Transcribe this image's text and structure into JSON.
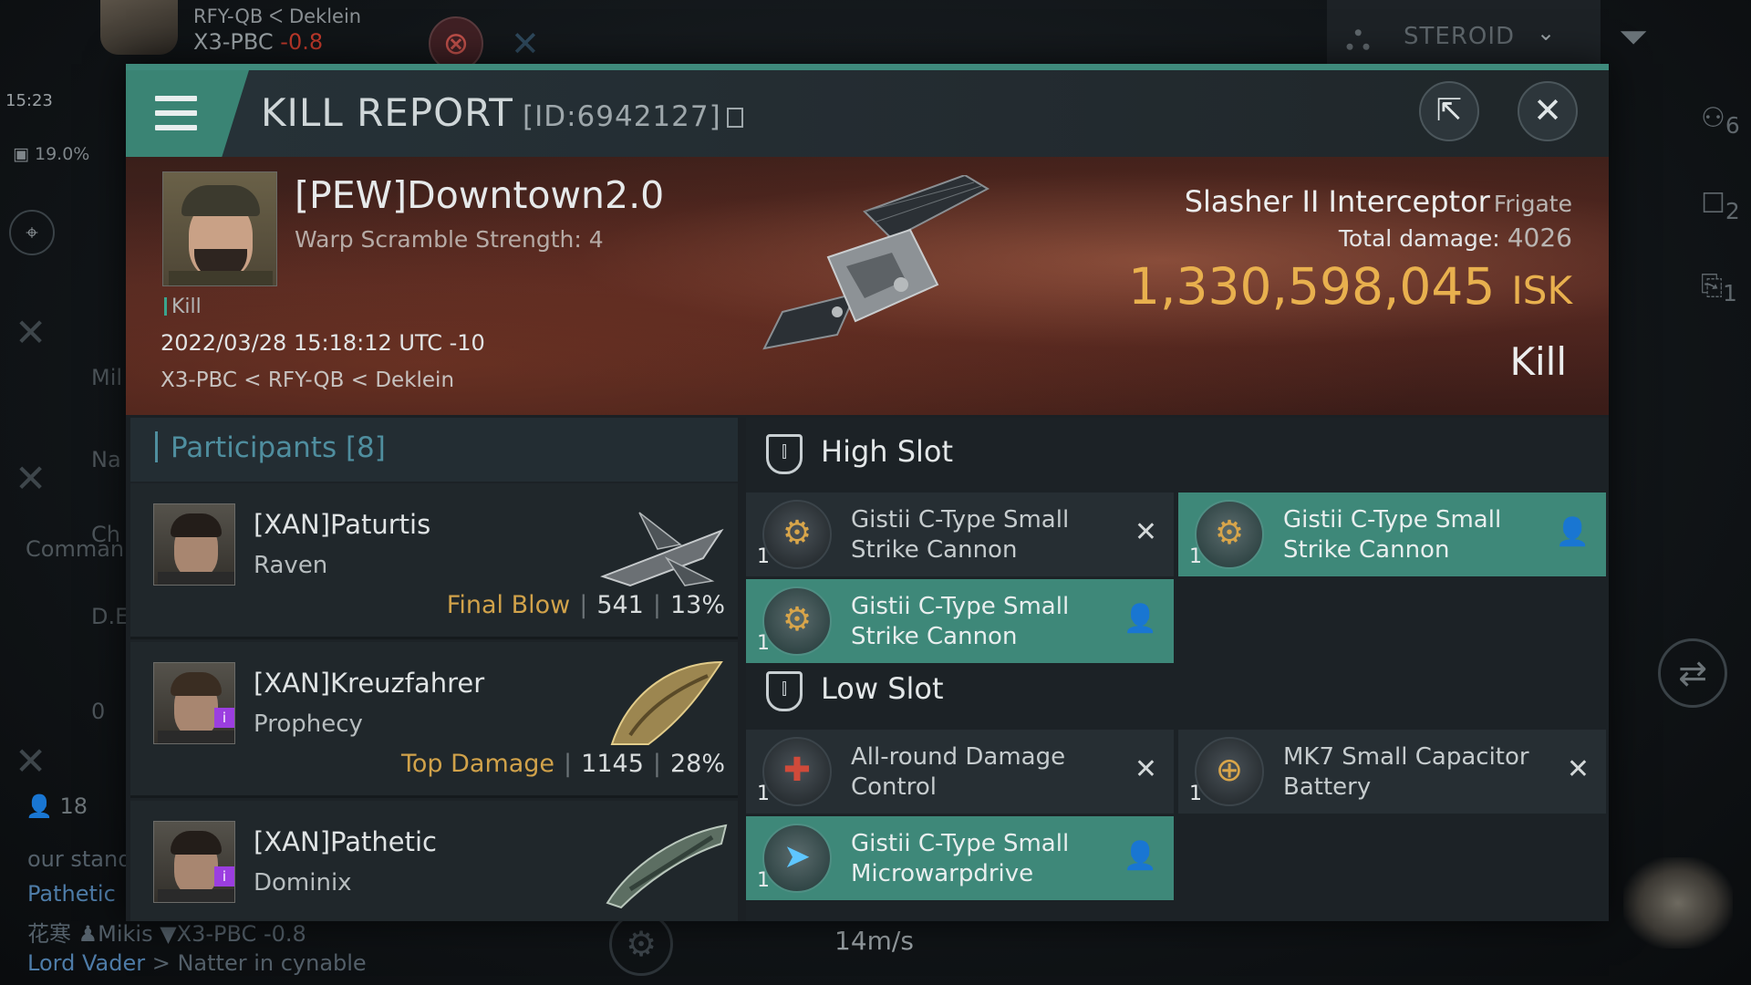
{
  "hud": {
    "location_path": "RFY-QB  ᐸ Deklein",
    "system": "X3-PBC",
    "security": "-0.8",
    "clock": "15:23",
    "cargo_pct": "19.0%",
    "filter_label": "STEROID",
    "users_count": "18",
    "speed": "14m/s",
    "chat": [
      {
        "name": "Pathetic",
        "text": ""
      },
      {
        "name": "",
        "text": "花寒 ♟Mikis ▼X3-PBC -0.8"
      },
      {
        "name": "Lord Vader",
        "text": "> Natter in cynable"
      }
    ],
    "side_labels": [
      "Mil",
      "Na",
      "Ch",
      "Comman",
      "D.E",
      "0",
      "our stand"
    ],
    "right_counts": [
      "6",
      "2",
      "1"
    ]
  },
  "report": {
    "title": "KILL REPORT",
    "id": "[ID:6942127]",
    "victim": {
      "name": "[PEW]Downtown2.0",
      "subtitle": "Warp Scramble Strength: 4",
      "tag": "Kill",
      "datetime": "2022/03/28 15:18:12 UTC -10",
      "location": "X3-PBC < RFY-QB < Deklein"
    },
    "ship": {
      "name": "Slasher II Interceptor",
      "class": "Frigate",
      "total_damage_label": "Total damage:",
      "total_damage": "4026",
      "value": "1,330,598,045",
      "currency": "ISK",
      "result": "Kill"
    }
  },
  "participants": {
    "header": "Participants [8]",
    "rows": [
      {
        "name": "[XAN]Paturtis",
        "ship": "Raven",
        "tag": "Final Blow",
        "damage": "541",
        "pct": "13%"
      },
      {
        "name": "[XAN]Kreuzfahrer",
        "ship": "Prophecy",
        "tag": "Top Damage",
        "damage": "1145",
        "pct": "28%"
      },
      {
        "name": "[XAN]Pathetic",
        "ship": "Dominix",
        "tag": "",
        "damage": "",
        "pct": ""
      }
    ]
  },
  "slots": {
    "high": {
      "label": "High Slot",
      "modules": [
        {
          "name": "Gistii C-Type Small Strike Cannon",
          "qty": "1",
          "status": "destroyed"
        },
        {
          "name": "Gistii C-Type Small Strike Cannon",
          "qty": "1",
          "status": "dropped"
        },
        {
          "name": "Gistii C-Type Small Strike Cannon",
          "qty": "1",
          "status": "dropped"
        }
      ]
    },
    "low": {
      "label": "Low Slot",
      "modules": [
        {
          "name": "All-round Damage Control",
          "qty": "1",
          "status": "destroyed"
        },
        {
          "name": "MK7 Small Capacitor Battery",
          "qty": "1",
          "status": "destroyed"
        },
        {
          "name": "Gistii C-Type Small Microwarpdrive",
          "qty": "1",
          "status": "dropped"
        }
      ]
    }
  },
  "colors": {
    "accent": "#3f8a7c",
    "isk": "#e8b04e",
    "tag": "#d1a24a",
    "participants_header": "#4f8e9f"
  }
}
